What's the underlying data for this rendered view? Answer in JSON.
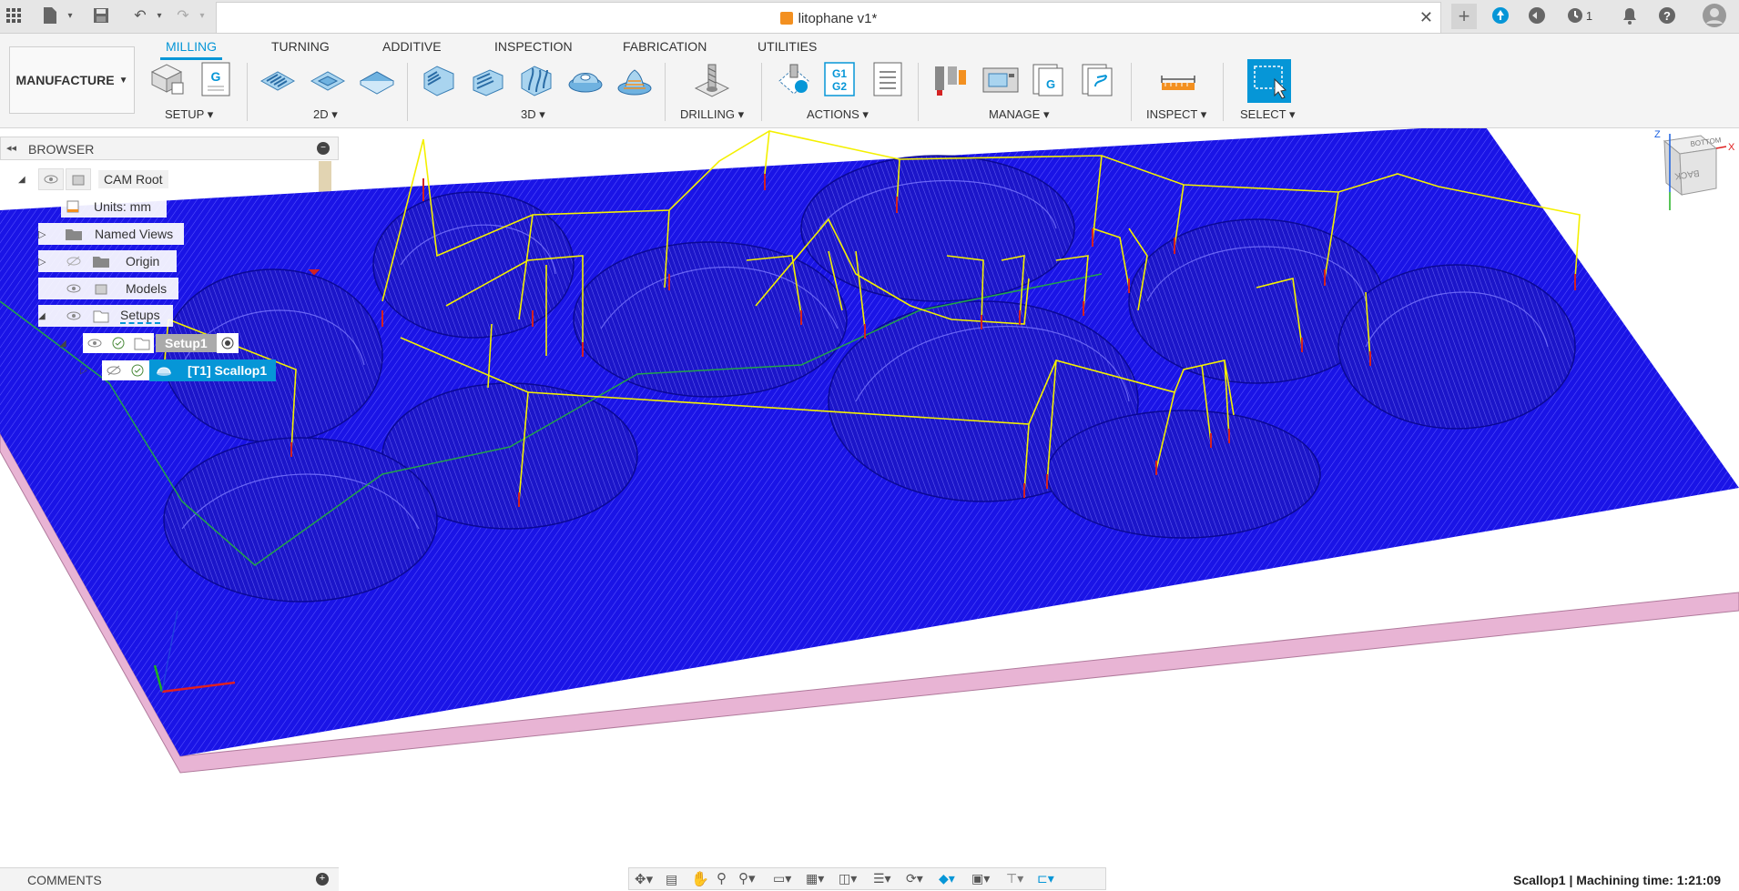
{
  "titlebar": {
    "doc_title": "litophane v1*",
    "job_count": "1"
  },
  "ribbon": {
    "workspace": "MANUFACTURE",
    "tabs": [
      {
        "label": "MILLING",
        "active": true
      },
      {
        "label": "TURNING",
        "active": false
      },
      {
        "label": "ADDITIVE",
        "active": false
      },
      {
        "label": "INSPECTION",
        "active": false
      },
      {
        "label": "FABRICATION",
        "active": false
      },
      {
        "label": "UTILITIES",
        "active": false
      }
    ],
    "groups": {
      "setup": "SETUP",
      "two_d": "2D",
      "three_d": "3D",
      "drilling": "DRILLING",
      "actions": "ACTIONS",
      "manage": "MANAGE",
      "inspect": "INSPECT",
      "select": "SELECT"
    }
  },
  "browser": {
    "title": "BROWSER",
    "nodes": {
      "cam_root": "CAM Root",
      "units": "Units: mm",
      "named_views": "Named Views",
      "origin": "Origin",
      "models": "Models",
      "setups": "Setups",
      "setup1": "Setup1",
      "scallop": "[T1] Scallop1"
    }
  },
  "viewcube": {
    "top_face": "BOTTOM",
    "front_face": "BACK",
    "axis_x": "X",
    "axis_z": "Z"
  },
  "comments": {
    "label": "COMMENTS"
  },
  "status": {
    "text": "Scallop1 | Machining time: 1:21:09"
  },
  "colors": {
    "accent": "#0696d7",
    "toolpath": "#1a14e6",
    "stock": "#e8b4d4",
    "rapid": "#f4f000",
    "lead": "#22a34a",
    "plunge": "#d42222"
  }
}
